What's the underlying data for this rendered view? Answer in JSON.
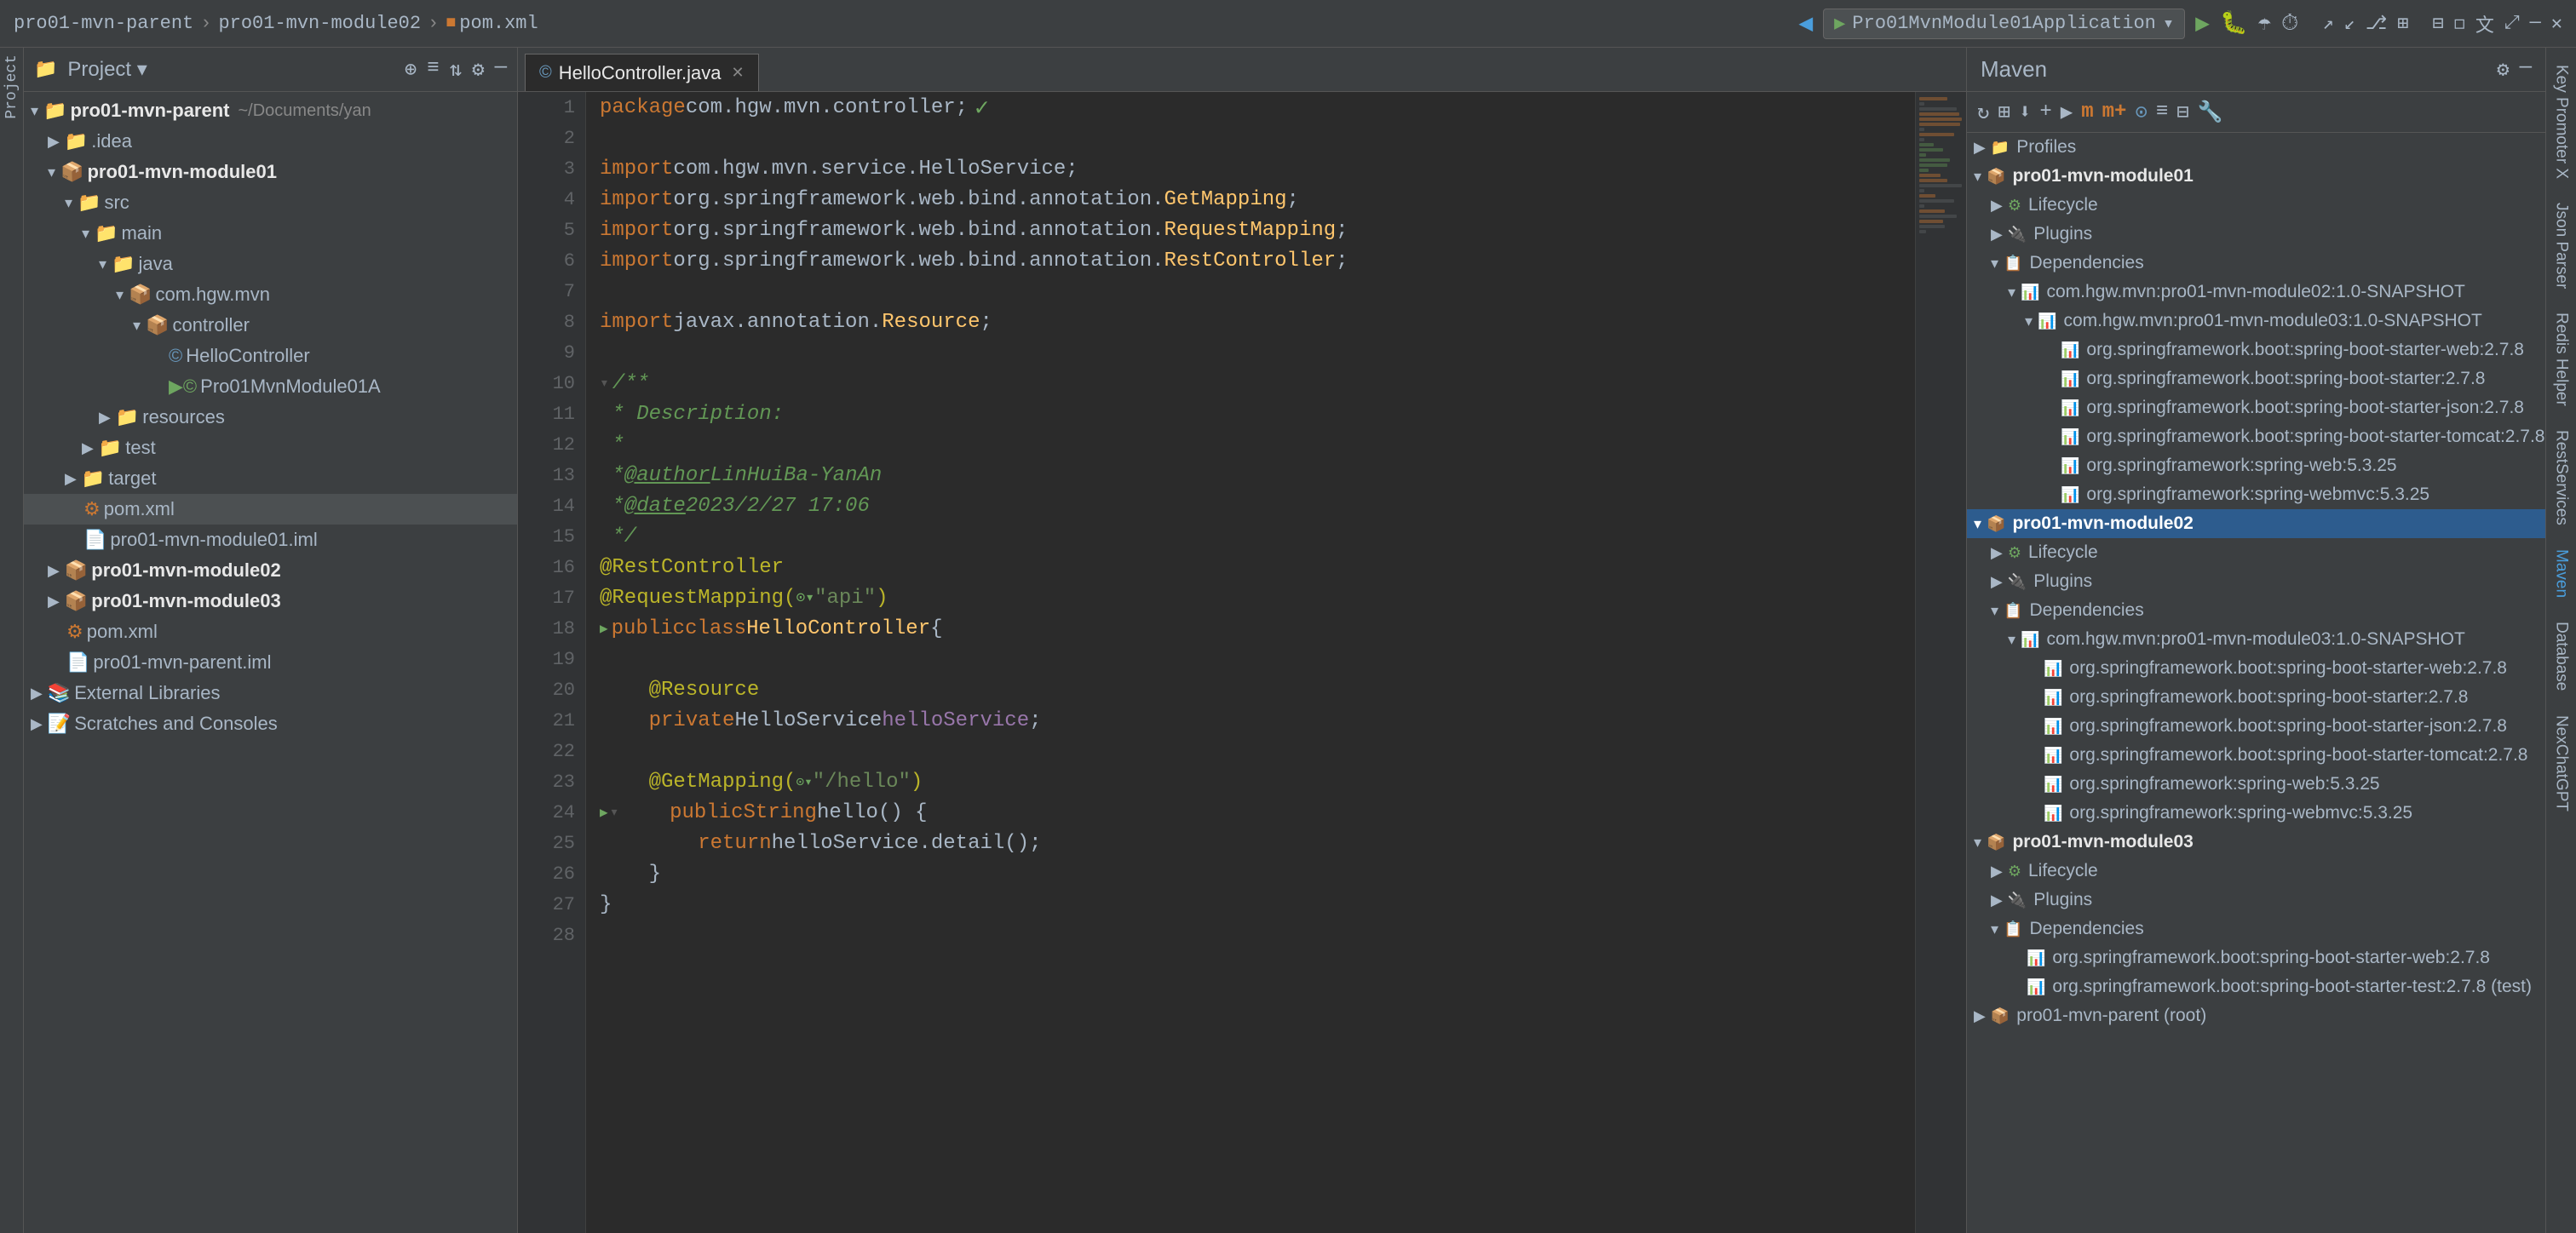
{
  "topbar": {
    "breadcrumbs": [
      "pro01-mvn-parent",
      "pro01-mvn-module02",
      "pom.xml"
    ],
    "run_config": "Pro01MvnModule01Application",
    "tab_label": "HelloController.java"
  },
  "project_panel": {
    "title": "Project",
    "tree": [
      {
        "id": "root",
        "label": "pro01-mvn-parent",
        "sub": "~/Documents/yan",
        "indent": 0,
        "type": "root",
        "expanded": true,
        "bold": true
      },
      {
        "id": "idea",
        "label": ".idea",
        "indent": 1,
        "type": "folder",
        "expanded": false
      },
      {
        "id": "module01",
        "label": "pro01-mvn-module01",
        "indent": 1,
        "type": "module",
        "expanded": true,
        "bold": true
      },
      {
        "id": "src",
        "label": "src",
        "indent": 2,
        "type": "folder",
        "expanded": true
      },
      {
        "id": "main",
        "label": "main",
        "indent": 3,
        "type": "folder",
        "expanded": true
      },
      {
        "id": "java",
        "label": "java",
        "indent": 4,
        "type": "source",
        "expanded": true
      },
      {
        "id": "com.hgw.mvn",
        "label": "com.hgw.mvn",
        "indent": 5,
        "type": "package",
        "expanded": true
      },
      {
        "id": "controller",
        "label": "controller",
        "indent": 6,
        "type": "package",
        "expanded": true
      },
      {
        "id": "HelloController",
        "label": "HelloController",
        "indent": 7,
        "type": "java",
        "expanded": false
      },
      {
        "id": "Pro01MvnModule01A",
        "label": "Pro01MvnModule01A",
        "indent": 7,
        "type": "java-app",
        "expanded": false
      },
      {
        "id": "resources",
        "label": "resources",
        "indent": 4,
        "type": "folder",
        "expanded": false
      },
      {
        "id": "test",
        "label": "test",
        "indent": 3,
        "type": "folder",
        "expanded": false
      },
      {
        "id": "target",
        "label": "target",
        "indent": 2,
        "type": "folder-target",
        "expanded": false
      },
      {
        "id": "pom.xml",
        "label": "pom.xml",
        "indent": 2,
        "type": "xml",
        "selected": true
      },
      {
        "id": "module01.iml",
        "label": "pro01-mvn-module01.iml",
        "indent": 2,
        "type": "iml"
      },
      {
        "id": "module02",
        "label": "pro01-mvn-module02",
        "indent": 1,
        "type": "module",
        "expanded": false,
        "bold": true
      },
      {
        "id": "module03",
        "label": "pro01-mvn-module03",
        "indent": 1,
        "type": "module",
        "expanded": false,
        "bold": true
      },
      {
        "id": "pom-parent",
        "label": "pom.xml",
        "indent": 1,
        "type": "xml"
      },
      {
        "id": "parent.iml",
        "label": "pro01-mvn-parent.iml",
        "indent": 1,
        "type": "iml"
      },
      {
        "id": "ext-libs",
        "label": "External Libraries",
        "indent": 0,
        "type": "libs",
        "expanded": false
      },
      {
        "id": "scratches",
        "label": "Scratches and Consoles",
        "indent": 0,
        "type": "scratch",
        "expanded": false
      }
    ]
  },
  "editor": {
    "filename": "HelloController.java",
    "lines": [
      {
        "num": 1,
        "tokens": [
          {
            "t": "package ",
            "c": "kw-orange"
          },
          {
            "t": "com.hgw.mvn.controller;",
            "c": "kw-white"
          }
        ]
      },
      {
        "num": 2,
        "tokens": []
      },
      {
        "num": 3,
        "tokens": [
          {
            "t": "import ",
            "c": "kw-orange"
          },
          {
            "t": "com.hgw.mvn.service.HelloService;",
            "c": "kw-white"
          }
        ]
      },
      {
        "num": 4,
        "tokens": [
          {
            "t": "import ",
            "c": "kw-orange"
          },
          {
            "t": "org.springframework.web.bind.annotation.",
            "c": "kw-white"
          },
          {
            "t": "GetMapping",
            "c": "kw-yellow"
          },
          {
            "t": ";",
            "c": "kw-white"
          }
        ]
      },
      {
        "num": 5,
        "tokens": [
          {
            "t": "import ",
            "c": "kw-orange"
          },
          {
            "t": "org.springframework.web.bind.annotation.",
            "c": "kw-white"
          },
          {
            "t": "RequestMapping",
            "c": "kw-yellow"
          },
          {
            "t": ";",
            "c": "kw-white"
          }
        ]
      },
      {
        "num": 6,
        "tokens": [
          {
            "t": "import ",
            "c": "kw-orange"
          },
          {
            "t": "org.springframework.web.bind.annotation.",
            "c": "kw-white"
          },
          {
            "t": "RestController",
            "c": "kw-yellow"
          },
          {
            "t": ";",
            "c": "kw-white"
          }
        ]
      },
      {
        "num": 7,
        "tokens": []
      },
      {
        "num": 8,
        "tokens": [
          {
            "t": "import ",
            "c": "kw-orange"
          },
          {
            "t": "javax.annotation.",
            "c": "kw-white"
          },
          {
            "t": "Resource",
            "c": "kw-yellow"
          },
          {
            "t": ";",
            "c": "kw-white"
          }
        ]
      },
      {
        "num": 9,
        "tokens": []
      },
      {
        "num": 10,
        "tokens": [
          {
            "t": "/**",
            "c": "kw-teal"
          }
        ],
        "fold": true
      },
      {
        "num": 11,
        "tokens": [
          {
            "t": " * Description:",
            "c": "kw-teal"
          }
        ]
      },
      {
        "num": 12,
        "tokens": [
          {
            "t": " *",
            "c": "kw-teal"
          }
        ]
      },
      {
        "num": 13,
        "tokens": [
          {
            "t": " * @author ",
            "c": "kw-teal"
          },
          {
            "t": "LinHuiBa-YanAn",
            "c": "kw-teal"
          }
        ]
      },
      {
        "num": 14,
        "tokens": [
          {
            "t": " * @date ",
            "c": "kw-teal"
          },
          {
            "t": "2023/2/27 17:06",
            "c": "kw-teal"
          }
        ]
      },
      {
        "num": 15,
        "tokens": [
          {
            "t": " */",
            "c": "kw-teal"
          }
        ]
      },
      {
        "num": 16,
        "tokens": [
          {
            "t": "@RestController",
            "c": "kw-annotation"
          }
        ]
      },
      {
        "num": 17,
        "tokens": [
          {
            "t": "@RequestMapping(",
            "c": "kw-annotation"
          },
          {
            "t": "\"api\"",
            "c": "kw-green"
          },
          {
            "t": ")",
            "c": "kw-annotation"
          }
        ]
      },
      {
        "num": 18,
        "tokens": [
          {
            "t": "public ",
            "c": "kw-orange"
          },
          {
            "t": "class ",
            "c": "kw-orange"
          },
          {
            "t": "HelloController ",
            "c": "kw-yellow"
          },
          {
            "t": "{",
            "c": "kw-white"
          }
        ],
        "has_icon": true
      },
      {
        "num": 19,
        "tokens": []
      },
      {
        "num": 20,
        "tokens": [
          {
            "t": "    @Resource",
            "c": "kw-annotation"
          }
        ]
      },
      {
        "num": 21,
        "tokens": [
          {
            "t": "    ",
            "c": "kw-white"
          },
          {
            "t": "private ",
            "c": "kw-orange"
          },
          {
            "t": "HelloService ",
            "c": "kw-white"
          },
          {
            "t": "helloService",
            "c": "kw-purple"
          },
          {
            "t": ";",
            "c": "kw-white"
          }
        ]
      },
      {
        "num": 22,
        "tokens": []
      },
      {
        "num": 23,
        "tokens": [
          {
            "t": "    @GetMapping(",
            "c": "kw-annotation"
          },
          {
            "t": "\"/hello\"",
            "c": "kw-green"
          },
          {
            "t": ")",
            "c": "kw-annotation"
          }
        ]
      },
      {
        "num": 24,
        "tokens": [
          {
            "t": "    ",
            "c": "kw-white"
          },
          {
            "t": "public ",
            "c": "kw-orange"
          },
          {
            "t": "String ",
            "c": "kw-orange"
          },
          {
            "t": "hello() {",
            "c": "kw-white"
          }
        ],
        "has_icon": true,
        "fold": true
      },
      {
        "num": 25,
        "tokens": [
          {
            "t": "        ",
            "c": "kw-white"
          },
          {
            "t": "return ",
            "c": "kw-orange"
          },
          {
            "t": "helloService",
            "c": "kw-white"
          },
          {
            "t": ".detail();",
            "c": "kw-white"
          }
        ]
      },
      {
        "num": 26,
        "tokens": [
          {
            "t": "    }",
            "c": "kw-white"
          }
        ]
      },
      {
        "num": 27,
        "tokens": [
          {
            "t": "}",
            "c": "kw-white"
          }
        ]
      },
      {
        "num": 28,
        "tokens": []
      }
    ]
  },
  "maven_panel": {
    "title": "Maven",
    "tree": [
      {
        "id": "profiles",
        "label": "Profiles",
        "indent": 0,
        "type": "section",
        "expanded": false
      },
      {
        "id": "module01",
        "label": "pro01-mvn-module01",
        "indent": 0,
        "type": "module",
        "expanded": true
      },
      {
        "id": "lifecycle01",
        "label": "Lifecycle",
        "indent": 1,
        "type": "lifecycle",
        "expanded": false
      },
      {
        "id": "plugins01",
        "label": "Plugins",
        "indent": 1,
        "type": "plugins",
        "expanded": false
      },
      {
        "id": "deps01",
        "label": "Dependencies",
        "indent": 1,
        "type": "deps",
        "expanded": true
      },
      {
        "id": "dep01-1",
        "label": "com.hgw.mvn:pro01-mvn-module02:1.0-SNAPSHOT",
        "indent": 2,
        "type": "dep",
        "expanded": true
      },
      {
        "id": "dep01-1-1",
        "label": "com.hgw.mvn:pro01-mvn-module03:1.0-SNAPSHOT",
        "indent": 3,
        "type": "dep",
        "expanded": true
      },
      {
        "id": "dep01-1-1-1",
        "label": "org.springframework.boot:spring-boot-starter-web:2.7.8",
        "indent": 4,
        "type": "dep"
      },
      {
        "id": "dep01-1-1-2",
        "label": "org.springframework.boot:spring-boot-starter:2.7.8",
        "indent": 4,
        "type": "dep"
      },
      {
        "id": "dep01-1-1-3",
        "label": "org.springframework.boot:spring-boot-starter-json:2.7.8",
        "indent": 4,
        "type": "dep"
      },
      {
        "id": "dep01-1-1-4",
        "label": "org.springframework.boot:spring-boot-starter-tomcat:2.7.8",
        "indent": 4,
        "type": "dep"
      },
      {
        "id": "dep01-1-1-5",
        "label": "org.springframework:spring-web:5.3.25",
        "indent": 4,
        "type": "dep"
      },
      {
        "id": "dep01-1-1-6",
        "label": "org.springframework:spring-webmvc:5.3.25",
        "indent": 4,
        "type": "dep"
      },
      {
        "id": "module02",
        "label": "pro01-mvn-module02",
        "indent": 0,
        "type": "module",
        "expanded": true,
        "selected": true
      },
      {
        "id": "lifecycle02",
        "label": "Lifecycle",
        "indent": 1,
        "type": "lifecycle",
        "expanded": false
      },
      {
        "id": "plugins02",
        "label": "Plugins",
        "indent": 1,
        "type": "plugins",
        "expanded": false
      },
      {
        "id": "deps02",
        "label": "Dependencies",
        "indent": 1,
        "type": "deps",
        "expanded": true
      },
      {
        "id": "dep02-1",
        "label": "com.hgw.mvn:pro01-mvn-module03:1.0-SNAPSHOT",
        "indent": 2,
        "type": "dep",
        "expanded": true
      },
      {
        "id": "dep02-1-1",
        "label": "org.springframework.boot:spring-boot-starter-web:2.7.8",
        "indent": 3,
        "type": "dep"
      },
      {
        "id": "dep02-1-2",
        "label": "org.springframework.boot:spring-boot-starter:2.7.8",
        "indent": 3,
        "type": "dep"
      },
      {
        "id": "dep02-1-3",
        "label": "org.springframework.boot:spring-boot-starter-json:2.7.8",
        "indent": 3,
        "type": "dep"
      },
      {
        "id": "dep02-1-4",
        "label": "org.springframework.boot:spring-boot-starter-tomcat:2.7.8",
        "indent": 3,
        "type": "dep"
      },
      {
        "id": "dep02-1-5",
        "label": "org.springframework:spring-web:5.3.25",
        "indent": 3,
        "type": "dep"
      },
      {
        "id": "dep02-1-6",
        "label": "org.springframework:spring-webmvc:5.3.25",
        "indent": 3,
        "type": "dep"
      },
      {
        "id": "module03",
        "label": "pro01-mvn-module03",
        "indent": 0,
        "type": "module",
        "expanded": true
      },
      {
        "id": "lifecycle03",
        "label": "Lifecycle",
        "indent": 1,
        "type": "lifecycle",
        "expanded": false
      },
      {
        "id": "plugins03",
        "label": "Plugins",
        "indent": 1,
        "type": "plugins",
        "expanded": false
      },
      {
        "id": "deps03",
        "label": "Dependencies",
        "indent": 1,
        "type": "deps",
        "expanded": true
      },
      {
        "id": "dep03-1",
        "label": "org.springframework.boot:spring-boot-starter-web:2.7.8",
        "indent": 2,
        "type": "dep"
      },
      {
        "id": "dep03-2",
        "label": "org.springframework.boot:spring-boot-starter-test:2.7.8 (test)",
        "indent": 2,
        "type": "dep"
      },
      {
        "id": "parent-root",
        "label": "pro01-mvn-parent (root)",
        "indent": 0,
        "type": "module",
        "expanded": false
      }
    ]
  },
  "right_tabs": [
    "Key Promoter X",
    "Json Parser",
    "Redis Helper",
    "RestServices",
    "NexChatGPT",
    "Database",
    "Maven"
  ]
}
